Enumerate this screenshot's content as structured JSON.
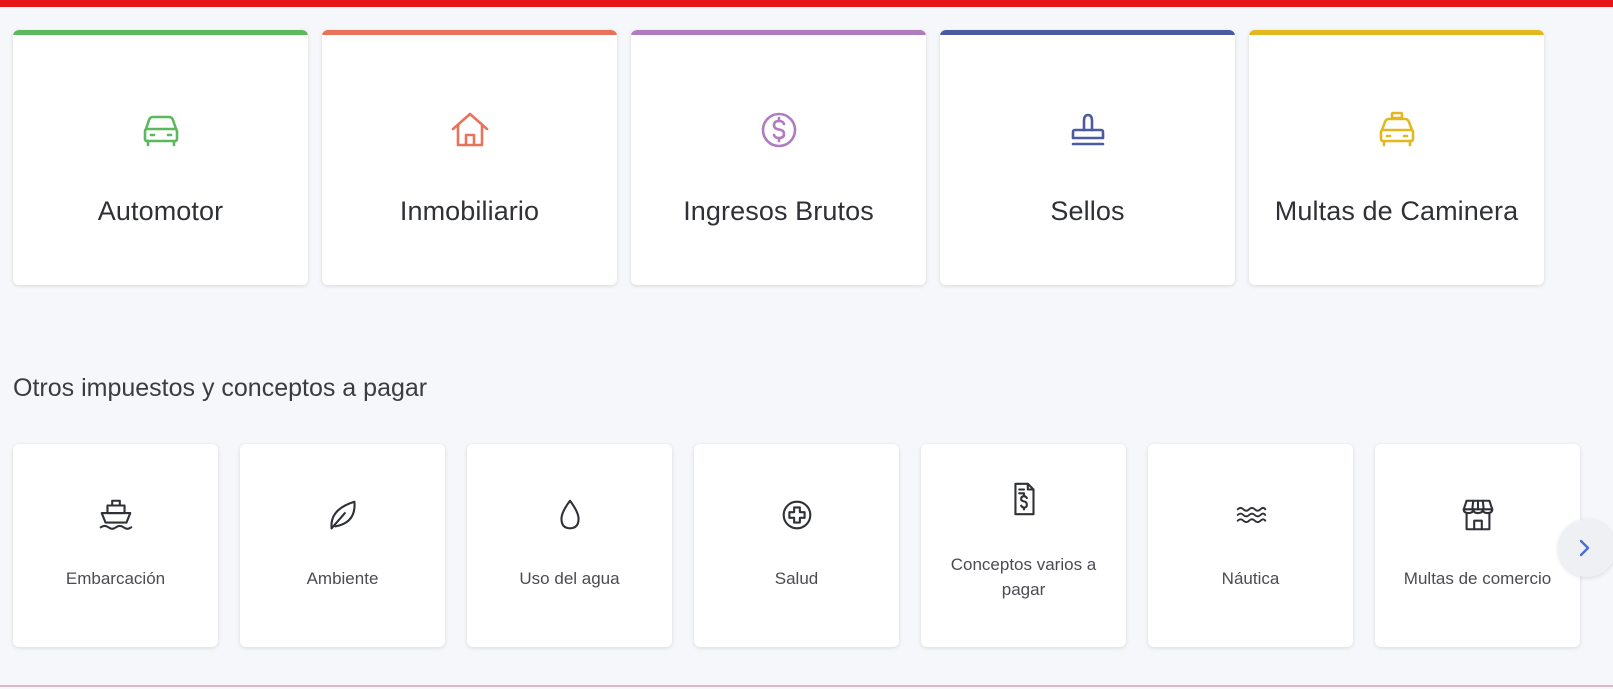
{
  "main_cards": [
    {
      "label": "Automotor",
      "icon": "car-icon",
      "accent": "#5cb85c"
    },
    {
      "label": "Inmobiliario",
      "icon": "home-icon",
      "accent": "#e8735a"
    },
    {
      "label": "Ingresos Brutos",
      "icon": "dollar-circle-icon",
      "accent": "#b07cbf"
    },
    {
      "label": "Sellos",
      "icon": "stamp-icon",
      "accent": "#4c5aa0"
    },
    {
      "label": "Multas de Caminera",
      "icon": "taxi-icon",
      "accent": "#e2b81f"
    }
  ],
  "section": {
    "title": "Otros impuestos y conceptos a pagar"
  },
  "other_cards": [
    {
      "label": "Embarcación",
      "icon": "ship-icon"
    },
    {
      "label": "Ambiente",
      "icon": "leaf-icon"
    },
    {
      "label": "Uso del agua",
      "icon": "water-drop-icon"
    },
    {
      "label": "Salud",
      "icon": "health-plus-icon"
    },
    {
      "label": "Conceptos varios a pagar",
      "icon": "invoice-icon"
    },
    {
      "label": "Náutica",
      "icon": "waves-icon"
    },
    {
      "label": "Multas de comercio",
      "icon": "store-icon"
    }
  ],
  "carousel": {
    "next_icon": "chevron-right-icon"
  },
  "colors": {
    "top_bar": "#e8141c",
    "icon_dark": "#2f3136"
  }
}
